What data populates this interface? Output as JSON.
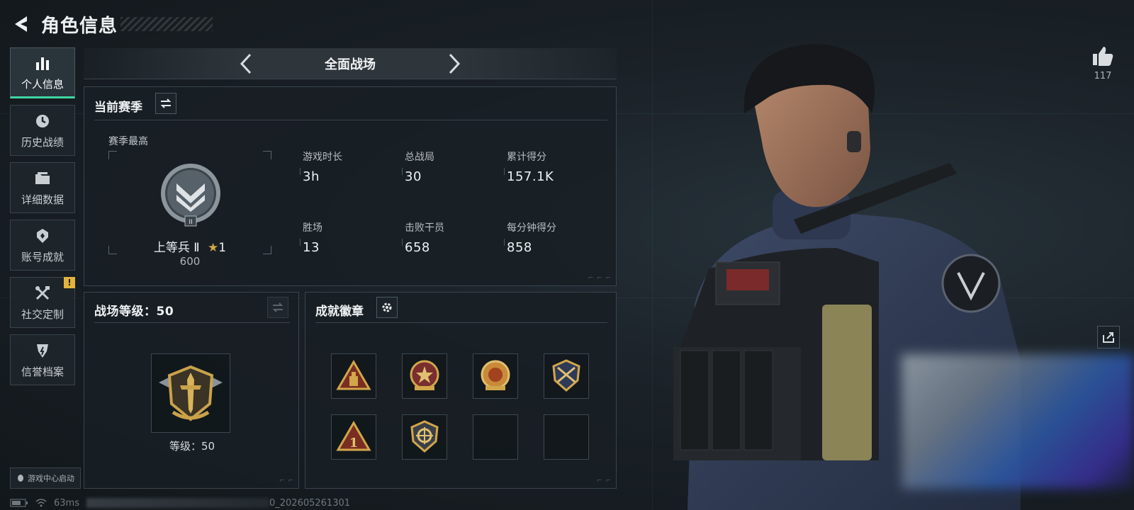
{
  "header": {
    "title": "角色信息"
  },
  "sidebar": {
    "items": [
      {
        "label": "个人信息",
        "icon": "bar-chart-icon",
        "active": true
      },
      {
        "label": "历史战绩",
        "icon": "history-icon"
      },
      {
        "label": "详细数据",
        "icon": "folder-icon"
      },
      {
        "label": "账号成就",
        "icon": "achievement-icon"
      },
      {
        "label": "社交定制",
        "icon": "tools-icon",
        "alert": "!"
      },
      {
        "label": "信誉档案",
        "icon": "reputation-icon"
      }
    ],
    "game_center": "游戏中心启动"
  },
  "mode": {
    "name": "全面战场"
  },
  "season": {
    "title": "当前赛季",
    "best_label": "赛季最高",
    "rank_name": "上等兵 Ⅱ",
    "rank_stars": "1",
    "rank_score": "600",
    "stats": [
      {
        "label": "游戏时长",
        "value": "3h"
      },
      {
        "label": "总战局",
        "value": "30"
      },
      {
        "label": "累计得分",
        "value": "157.1K"
      },
      {
        "label": "胜场",
        "value": "13"
      },
      {
        "label": "击败干员",
        "value": "658"
      },
      {
        "label": "每分钟得分",
        "value": "858"
      }
    ]
  },
  "battle_level": {
    "title": "战场等级：50",
    "level_text": "等级：50"
  },
  "achievements": {
    "title": "成就徽章",
    "badges": [
      {
        "name": "triangle-ammo-badge",
        "filled": true
      },
      {
        "name": "star-emblem-badge",
        "filled": true
      },
      {
        "name": "tiger-emblem-badge",
        "filled": true
      },
      {
        "name": "shield-emblem-badge",
        "filled": true
      },
      {
        "name": "triangle-one-badge",
        "filled": true
      },
      {
        "name": "crosshair-shield-badge",
        "filled": true
      },
      {
        "name": "empty-slot",
        "filled": false
      },
      {
        "name": "empty-slot",
        "filled": false
      }
    ]
  },
  "likes": {
    "count": "117"
  },
  "footer": {
    "ping": "63ms",
    "build": "0_202605261301"
  },
  "colors": {
    "accent": "#3fd6a2",
    "alert": "#e3b43a",
    "panel_border": "#3a444c",
    "gold": "#c9a24a"
  }
}
